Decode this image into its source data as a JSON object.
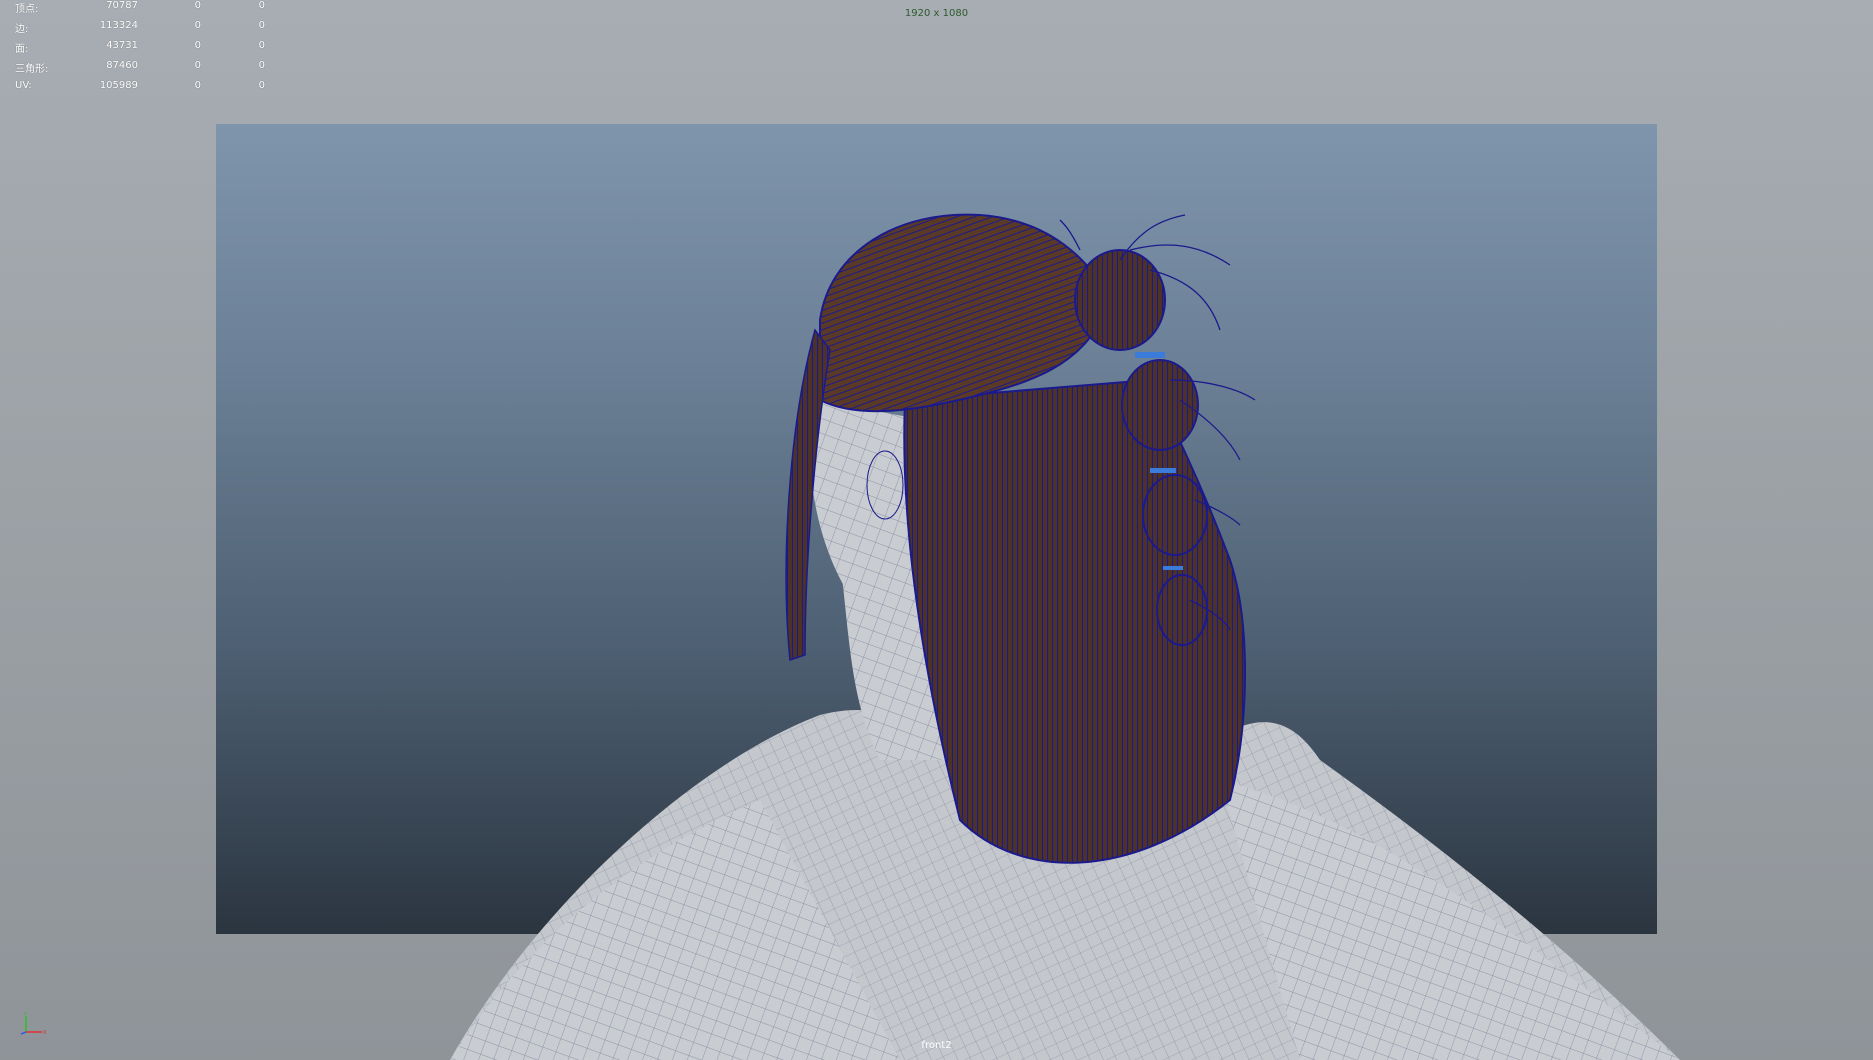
{
  "hud": {
    "rows": [
      {
        "label": "顶点:",
        "v1": "70787",
        "v2": "0",
        "v3": "0"
      },
      {
        "label": "边:",
        "v1": "113324",
        "v2": "0",
        "v3": "0"
      },
      {
        "label": "面:",
        "v1": "43731",
        "v2": "0",
        "v3": "0"
      },
      {
        "label": "三角形:",
        "v1": "87460",
        "v2": "0",
        "v3": "0"
      },
      {
        "label": "UV:",
        "v1": "105989",
        "v2": "0",
        "v3": "0"
      }
    ]
  },
  "resolution_gate_label": "1920 x 1080",
  "camera_name": "front2",
  "colors": {
    "wireframe": "#1a1a8a",
    "hair_fill": "#5a3a2a",
    "body_fill": "#c8cbd0",
    "gate_top": "#7f95ab",
    "gate_bottom": "#2b3540"
  },
  "icons": {
    "axis_gizmo": "xyz-axis-icon"
  }
}
